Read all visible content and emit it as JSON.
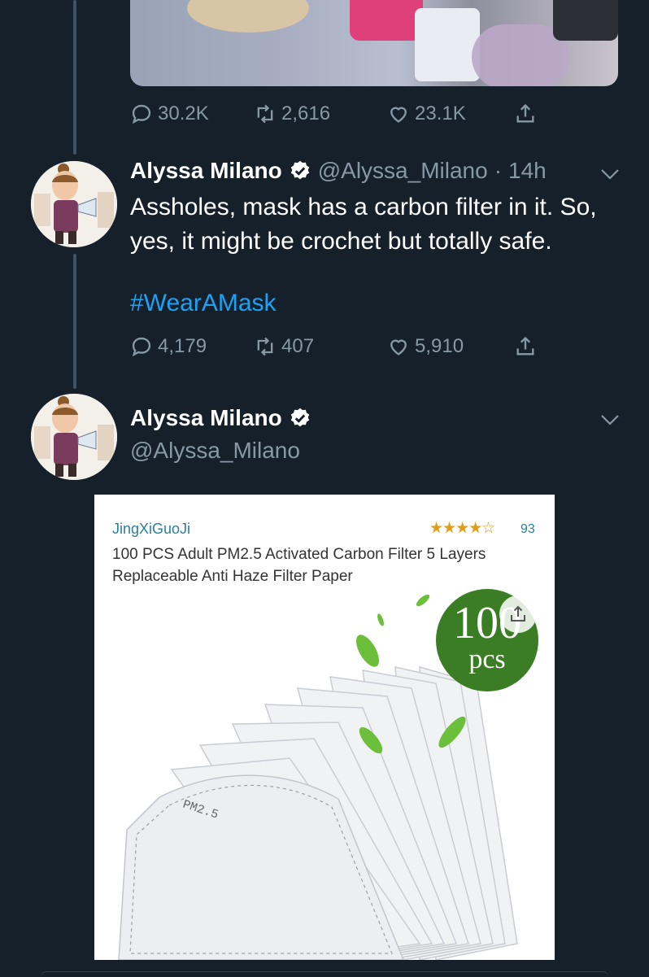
{
  "previous_tweet": {
    "stats": {
      "replies": "30.2K",
      "retweets": "2,616",
      "likes": "23.1K"
    }
  },
  "tweet1": {
    "name": "Alyssa Milano",
    "handle": "@Alyssa_Milano",
    "separator": "·",
    "time": "14h",
    "text": "Assholes, mask has a carbon filter in it. So, yes, it might be crochet but totally safe.",
    "hashtag": "#WearAMask",
    "stats": {
      "replies": "4,179",
      "retweets": "407",
      "likes": "5,910"
    }
  },
  "tweet2": {
    "name": "Alyssa Milano",
    "handle": "@Alyssa_Milano"
  },
  "product": {
    "seller": "JingXiGuoJi",
    "stars": "★★★★☆",
    "rating_count": "93",
    "title": "100 PCS Adult PM2.5 Activated Carbon Filter 5 Layers Replaceable Anti Haze Filter Paper",
    "badge_number": "100",
    "badge_unit": "pcs",
    "filter_label": "PM2.5"
  },
  "colors": {
    "background": "#15202b",
    "muted": "#8899a6",
    "link": "#1da1f2",
    "verified": "#ffffff",
    "badge": "#3b7d24"
  },
  "icons": {
    "reply": "reply-icon",
    "retweet": "retweet-icon",
    "like": "heart-icon",
    "share": "share-icon",
    "verified": "verified-badge-icon",
    "chevron": "chevron-down-icon"
  }
}
